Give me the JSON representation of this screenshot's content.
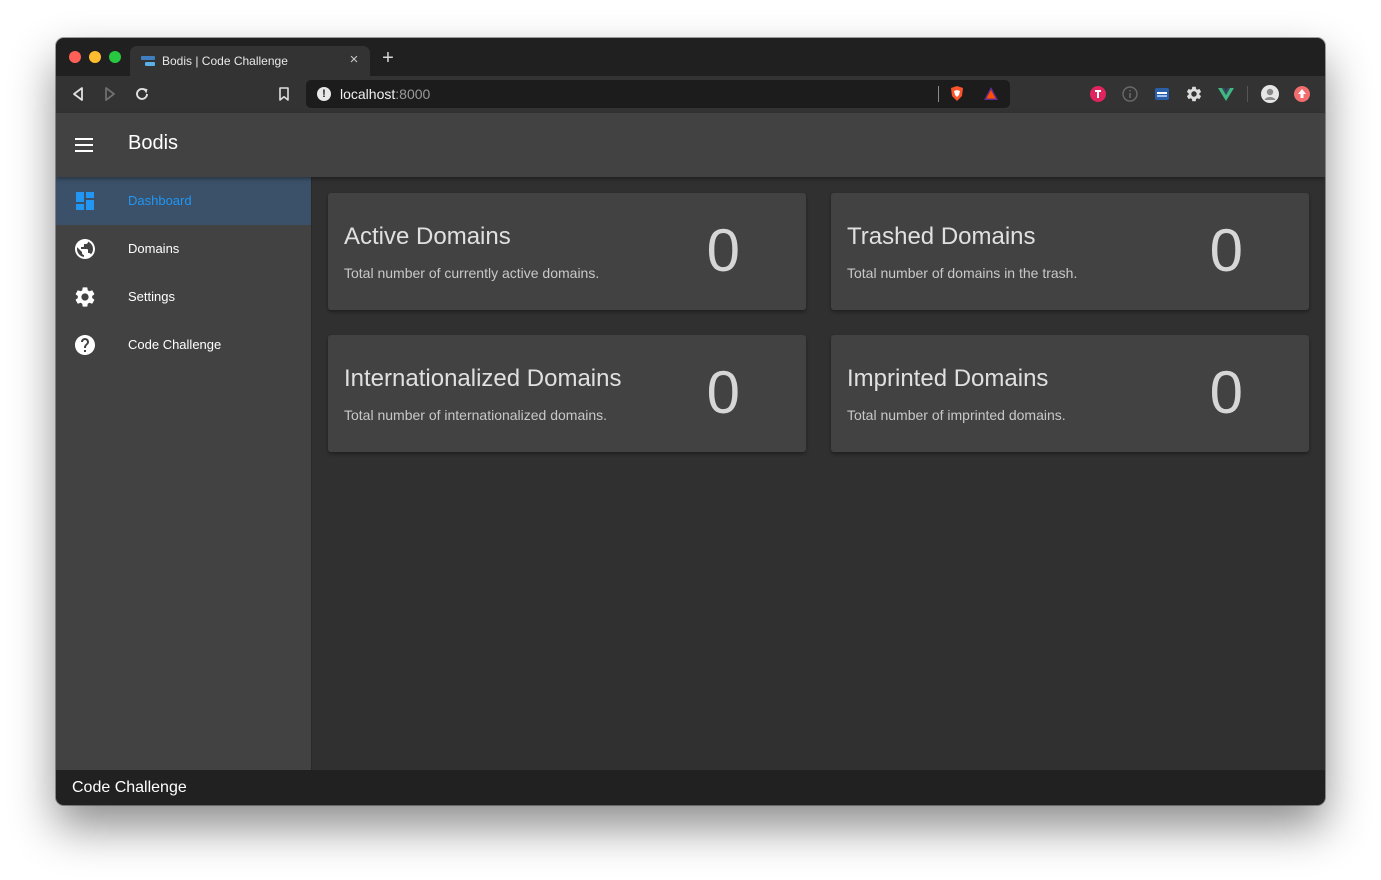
{
  "browser": {
    "tab_title": "Bodis | Code Challenge",
    "close_tab_glyph": "×",
    "new_tab_glyph": "+",
    "url_host": "localhost",
    "url_port": ":8000",
    "url_info_glyph": "!",
    "icons": [
      "back-icon",
      "forward-icon",
      "reload-icon",
      "bookmark-icon",
      "brave-shields-icon",
      "brave-rewards-icon",
      "extension-red-icon",
      "extension-info-icon",
      "extension-window-icon",
      "extension-gear-icon",
      "vue-devtools-icon",
      "profile-avatar-icon",
      "update-icon"
    ]
  },
  "app": {
    "title": "Bodis",
    "accent_color": "#2196f3"
  },
  "sidebar": {
    "items": [
      {
        "label": "Dashboard",
        "icon": "dashboard-icon",
        "active": true
      },
      {
        "label": "Domains",
        "icon": "globe-icon",
        "active": false
      },
      {
        "label": "Settings",
        "icon": "gear-icon",
        "active": false
      },
      {
        "label": "Code Challenge",
        "icon": "help-icon",
        "active": false
      }
    ]
  },
  "cards": [
    {
      "title": "Active Domains",
      "subtitle": "Total number of currently active domains.",
      "count": "0"
    },
    {
      "title": "Trashed Domains",
      "subtitle": "Total number of domains in the trash.",
      "count": "0"
    },
    {
      "title": "Internationalized Domains",
      "subtitle": "Total number of internationalized domains.",
      "count": "0"
    },
    {
      "title": "Imprinted Domains",
      "subtitle": "Total number of imprinted domains.",
      "count": "0"
    }
  ],
  "footer": {
    "text": "Code Challenge"
  }
}
